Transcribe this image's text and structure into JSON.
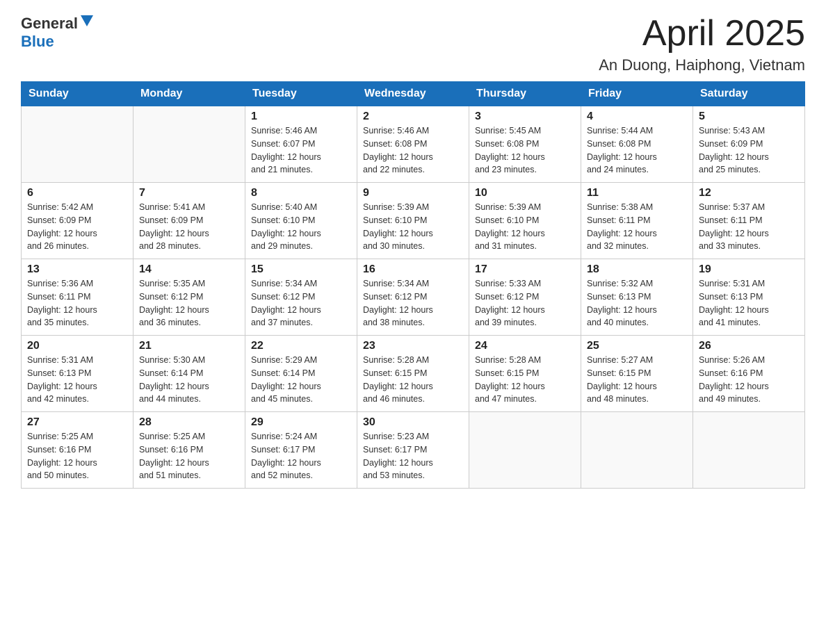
{
  "logo": {
    "general": "General",
    "blue": "Blue"
  },
  "title": "April 2025",
  "location": "An Duong, Haiphong, Vietnam",
  "days_of_week": [
    "Sunday",
    "Monday",
    "Tuesday",
    "Wednesday",
    "Thursday",
    "Friday",
    "Saturday"
  ],
  "weeks": [
    [
      {
        "day": "",
        "info": ""
      },
      {
        "day": "",
        "info": ""
      },
      {
        "day": "1",
        "info": "Sunrise: 5:46 AM\nSunset: 6:07 PM\nDaylight: 12 hours\nand 21 minutes."
      },
      {
        "day": "2",
        "info": "Sunrise: 5:46 AM\nSunset: 6:08 PM\nDaylight: 12 hours\nand 22 minutes."
      },
      {
        "day": "3",
        "info": "Sunrise: 5:45 AM\nSunset: 6:08 PM\nDaylight: 12 hours\nand 23 minutes."
      },
      {
        "day": "4",
        "info": "Sunrise: 5:44 AM\nSunset: 6:08 PM\nDaylight: 12 hours\nand 24 minutes."
      },
      {
        "day": "5",
        "info": "Sunrise: 5:43 AM\nSunset: 6:09 PM\nDaylight: 12 hours\nand 25 minutes."
      }
    ],
    [
      {
        "day": "6",
        "info": "Sunrise: 5:42 AM\nSunset: 6:09 PM\nDaylight: 12 hours\nand 26 minutes."
      },
      {
        "day": "7",
        "info": "Sunrise: 5:41 AM\nSunset: 6:09 PM\nDaylight: 12 hours\nand 28 minutes."
      },
      {
        "day": "8",
        "info": "Sunrise: 5:40 AM\nSunset: 6:10 PM\nDaylight: 12 hours\nand 29 minutes."
      },
      {
        "day": "9",
        "info": "Sunrise: 5:39 AM\nSunset: 6:10 PM\nDaylight: 12 hours\nand 30 minutes."
      },
      {
        "day": "10",
        "info": "Sunrise: 5:39 AM\nSunset: 6:10 PM\nDaylight: 12 hours\nand 31 minutes."
      },
      {
        "day": "11",
        "info": "Sunrise: 5:38 AM\nSunset: 6:11 PM\nDaylight: 12 hours\nand 32 minutes."
      },
      {
        "day": "12",
        "info": "Sunrise: 5:37 AM\nSunset: 6:11 PM\nDaylight: 12 hours\nand 33 minutes."
      }
    ],
    [
      {
        "day": "13",
        "info": "Sunrise: 5:36 AM\nSunset: 6:11 PM\nDaylight: 12 hours\nand 35 minutes."
      },
      {
        "day": "14",
        "info": "Sunrise: 5:35 AM\nSunset: 6:12 PM\nDaylight: 12 hours\nand 36 minutes."
      },
      {
        "day": "15",
        "info": "Sunrise: 5:34 AM\nSunset: 6:12 PM\nDaylight: 12 hours\nand 37 minutes."
      },
      {
        "day": "16",
        "info": "Sunrise: 5:34 AM\nSunset: 6:12 PM\nDaylight: 12 hours\nand 38 minutes."
      },
      {
        "day": "17",
        "info": "Sunrise: 5:33 AM\nSunset: 6:12 PM\nDaylight: 12 hours\nand 39 minutes."
      },
      {
        "day": "18",
        "info": "Sunrise: 5:32 AM\nSunset: 6:13 PM\nDaylight: 12 hours\nand 40 minutes."
      },
      {
        "day": "19",
        "info": "Sunrise: 5:31 AM\nSunset: 6:13 PM\nDaylight: 12 hours\nand 41 minutes."
      }
    ],
    [
      {
        "day": "20",
        "info": "Sunrise: 5:31 AM\nSunset: 6:13 PM\nDaylight: 12 hours\nand 42 minutes."
      },
      {
        "day": "21",
        "info": "Sunrise: 5:30 AM\nSunset: 6:14 PM\nDaylight: 12 hours\nand 44 minutes."
      },
      {
        "day": "22",
        "info": "Sunrise: 5:29 AM\nSunset: 6:14 PM\nDaylight: 12 hours\nand 45 minutes."
      },
      {
        "day": "23",
        "info": "Sunrise: 5:28 AM\nSunset: 6:15 PM\nDaylight: 12 hours\nand 46 minutes."
      },
      {
        "day": "24",
        "info": "Sunrise: 5:28 AM\nSunset: 6:15 PM\nDaylight: 12 hours\nand 47 minutes."
      },
      {
        "day": "25",
        "info": "Sunrise: 5:27 AM\nSunset: 6:15 PM\nDaylight: 12 hours\nand 48 minutes."
      },
      {
        "day": "26",
        "info": "Sunrise: 5:26 AM\nSunset: 6:16 PM\nDaylight: 12 hours\nand 49 minutes."
      }
    ],
    [
      {
        "day": "27",
        "info": "Sunrise: 5:25 AM\nSunset: 6:16 PM\nDaylight: 12 hours\nand 50 minutes."
      },
      {
        "day": "28",
        "info": "Sunrise: 5:25 AM\nSunset: 6:16 PM\nDaylight: 12 hours\nand 51 minutes."
      },
      {
        "day": "29",
        "info": "Sunrise: 5:24 AM\nSunset: 6:17 PM\nDaylight: 12 hours\nand 52 minutes."
      },
      {
        "day": "30",
        "info": "Sunrise: 5:23 AM\nSunset: 6:17 PM\nDaylight: 12 hours\nand 53 minutes."
      },
      {
        "day": "",
        "info": ""
      },
      {
        "day": "",
        "info": ""
      },
      {
        "day": "",
        "info": ""
      }
    ]
  ]
}
